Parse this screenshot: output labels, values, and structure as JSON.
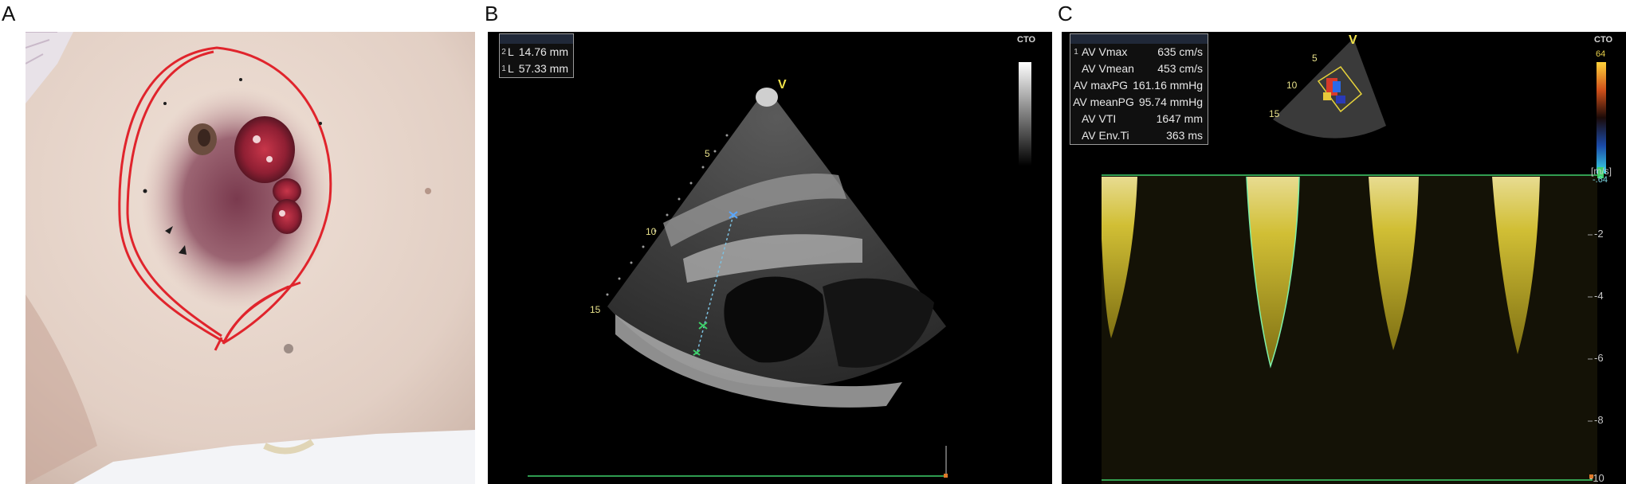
{
  "panels": {
    "a": {
      "letter": "A"
    },
    "b": {
      "letter": "B",
      "measurements": [
        {
          "index": "2",
          "label": "L",
          "value": "14.76 mm"
        },
        {
          "index": "1",
          "label": "L",
          "value": "57.33 mm"
        }
      ],
      "cto": "CTO",
      "probe_marker": "V",
      "depth_labels": [
        "5",
        "10",
        "15"
      ]
    },
    "c": {
      "letter": "C",
      "measurements": [
        {
          "index": "1",
          "label": "AV Vmax",
          "value": "635 cm/s"
        },
        {
          "index": "",
          "label": "AV Vmean",
          "value": "453 cm/s"
        },
        {
          "index": "",
          "label": "AV maxPG",
          "value": "161.16 mmHg"
        },
        {
          "index": "",
          "label": "AV meanPG",
          "value": "95.74 mmHg"
        },
        {
          "index": "",
          "label": "AV VTI",
          "value": "1647 mm"
        },
        {
          "index": "",
          "label": "AV Env.Ti",
          "value": "363 ms"
        }
      ],
      "cto": "CTO",
      "probe_marker": "V",
      "depth_labels": [
        "5",
        "10",
        "15"
      ],
      "color_scale": {
        "top": "64",
        "bottom": "-.64"
      },
      "velocity_unit": "[m/s]",
      "velocity_ticks": [
        "-2",
        "-4",
        "-6",
        "-8",
        "-10"
      ],
      "colors": {
        "doppler": "#e6d23a",
        "baseline": "#3fd06a"
      }
    }
  }
}
